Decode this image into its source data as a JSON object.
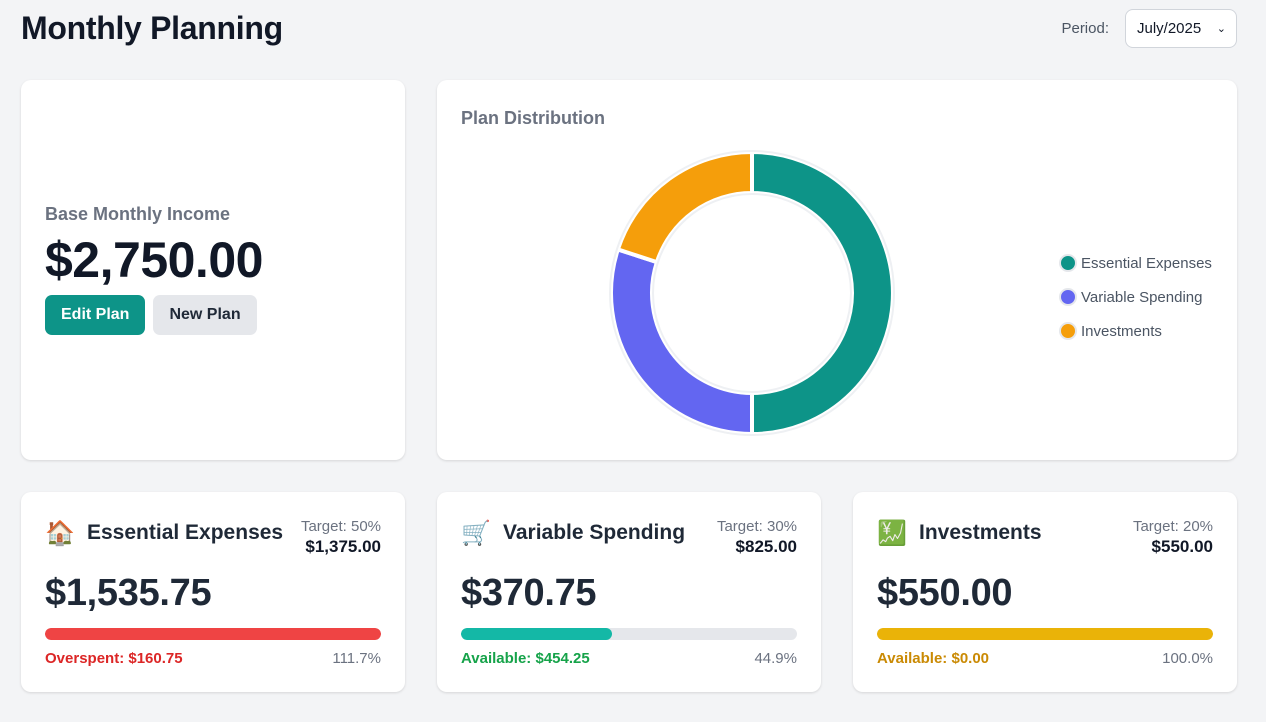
{
  "header": {
    "title": "Monthly Planning",
    "period_label": "Period:",
    "period_value": "July/2025"
  },
  "income": {
    "label": "Base Monthly Income",
    "value": "$2,750.00",
    "edit_label": "Edit Plan",
    "new_label": "New Plan"
  },
  "chart": {
    "title": "Plan Distribution"
  },
  "chart_data": {
    "type": "pie",
    "style": "donut",
    "categories": [
      "Essential Expenses",
      "Variable Spending",
      "Investments"
    ],
    "values": [
      50,
      30,
      20
    ],
    "colors": [
      "#0d9488",
      "#6366f1",
      "#f59e0b"
    ],
    "legend": "right"
  },
  "categories": [
    {
      "icon": "house-icon",
      "emoji": "🏠",
      "name": "Essential Expenses",
      "target_label": "Target: 50%",
      "target_value": "$1,375.00",
      "amount": "$1,535.75",
      "progress": 1.0,
      "bar_color": "#ef4444",
      "status": "Overspent: $160.75",
      "status_color": "#dc2626",
      "percent": "111.7%"
    },
    {
      "icon": "shopping-cart-icon",
      "emoji": "🛒",
      "name": "Variable Spending",
      "target_label": "Target: 30%",
      "target_value": "$825.00",
      "amount": "$370.75",
      "progress": 0.449,
      "bar_color": "#14b8a6",
      "status": "Available: $454.25",
      "status_color": "#16a34a",
      "percent": "44.9%"
    },
    {
      "icon": "chart-increasing-yen-icon",
      "emoji": "💹",
      "name": "Investments",
      "target_label": "Target: 20%",
      "target_value": "$550.00",
      "amount": "$550.00",
      "progress": 1.0,
      "bar_color": "#eab308",
      "status": "Available: $0.00",
      "status_color": "#ca8a04",
      "percent": "100.0%"
    }
  ]
}
